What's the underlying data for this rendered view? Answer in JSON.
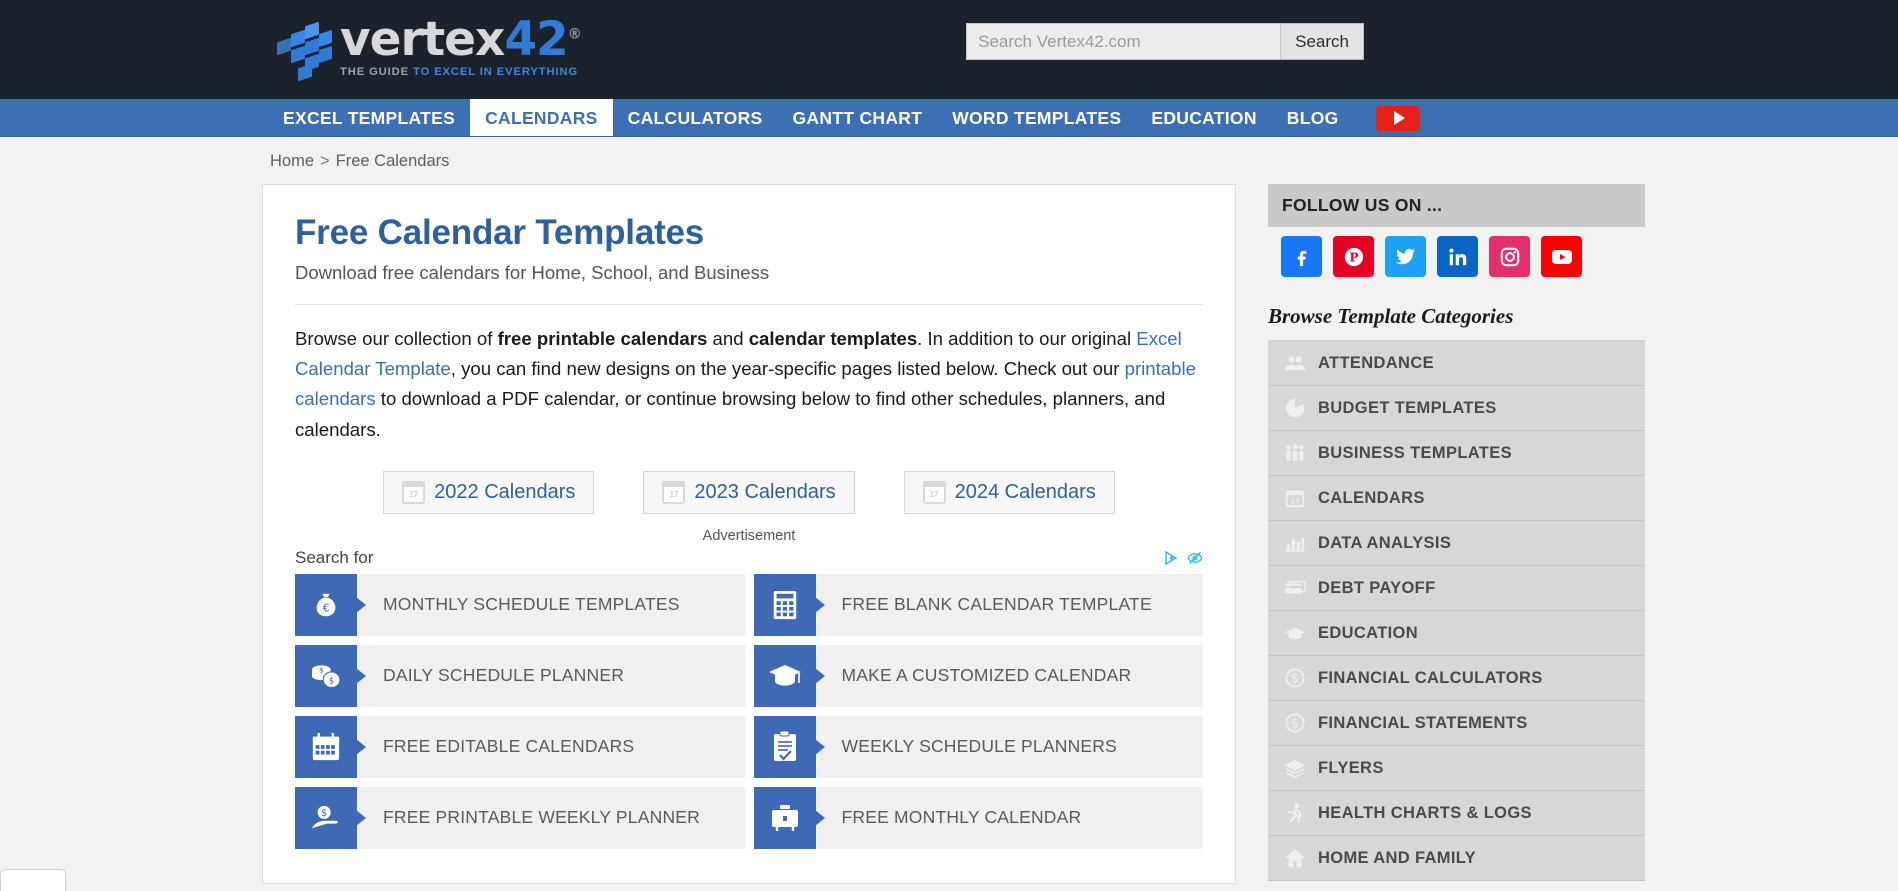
{
  "header": {
    "logo_word": "vertex",
    "logo_number": "42",
    "logo_reg": "®",
    "tagline_pre": "THE GUIDE ",
    "tagline_hi": "TO EXCEL IN EVERYTHING",
    "search_placeholder": "Search Vertex42.com",
    "search_value": "",
    "search_button": "Search"
  },
  "nav": {
    "items": [
      {
        "label": "EXCEL TEMPLATES",
        "active": false
      },
      {
        "label": "CALENDARS",
        "active": true
      },
      {
        "label": "CALCULATORS",
        "active": false
      },
      {
        "label": "GANTT CHART",
        "active": false
      },
      {
        "label": "WORD TEMPLATES",
        "active": false
      },
      {
        "label": "EDUCATION",
        "active": false
      },
      {
        "label": "BLOG",
        "active": false
      }
    ],
    "youtube_label": "YouTube"
  },
  "breadcrumb": {
    "home": "Home",
    "separator": ">",
    "current": "Free Calendars"
  },
  "main": {
    "title": "Free Calendar Templates",
    "subtitle": "Download free calendars for Home, School, and Business",
    "intro": {
      "t1": "Browse our collection of ",
      "b1": "free printable calendars",
      "t2": " and ",
      "b2": "calendar templates",
      "t3": ". In addition to our original ",
      "link1": "Excel Calendar Template",
      "t4": ", you can find new designs on the year-specific pages listed below. Check out our ",
      "link2": "printable calendars",
      "t5": " to download a PDF calendar, or continue browsing below to find other schedules, planners, and calendars."
    },
    "year_buttons": [
      {
        "label": "2022 Calendars"
      },
      {
        "label": "2023 Calendars"
      },
      {
        "label": "2024 Calendars"
      }
    ]
  },
  "ad": {
    "advertisement_label": "Advertisement",
    "search_for_label": "Search for",
    "adchoices_icon": "adchoices-icon",
    "hide_ad_icon": "hide-ad-icon",
    "tiles": [
      {
        "label": "MONTHLY SCHEDULE TEMPLATES",
        "icon": "money-bag-icon"
      },
      {
        "label": "FREE BLANK CALENDAR TEMPLATE",
        "icon": "calculator-icon"
      },
      {
        "label": "DAILY SCHEDULE PLANNER",
        "icon": "coins-icon"
      },
      {
        "label": "MAKE A CUSTOMIZED CALENDAR",
        "icon": "graduation-cap-icon"
      },
      {
        "label": "FREE EDITABLE CALENDARS",
        "icon": "calendar-icon"
      },
      {
        "label": "WEEKLY SCHEDULE PLANNERS",
        "icon": "clipboard-check-icon"
      },
      {
        "label": "FREE PRINTABLE WEEKLY PLANNER",
        "icon": "hand-money-icon"
      },
      {
        "label": "FREE MONTHLY CALENDAR",
        "icon": "briefcase-icon"
      }
    ]
  },
  "sidebar": {
    "follow_title": "FOLLOW US ON ...",
    "social": [
      {
        "name": "facebook",
        "glyph": "f",
        "color": "#1877f2"
      },
      {
        "name": "pinterest",
        "glyph": "P",
        "color": "#e60023"
      },
      {
        "name": "twitter",
        "glyph": "t",
        "color": "#1da1f2"
      },
      {
        "name": "linkedin",
        "glyph": "in",
        "color": "#0a66c2"
      },
      {
        "name": "instagram",
        "glyph": "o",
        "color": "#e1306c"
      },
      {
        "name": "youtube",
        "glyph": "▶",
        "color": "#ff0000"
      }
    ],
    "browse_title": "Browse Template Categories",
    "categories": [
      {
        "label": "ATTENDANCE",
        "icon": "people-icon"
      },
      {
        "label": "BUDGET TEMPLATES",
        "icon": "pie-chart-icon"
      },
      {
        "label": "BUSINESS TEMPLATES",
        "icon": "group-icon"
      },
      {
        "label": "CALENDARS",
        "icon": "calendar-icon"
      },
      {
        "label": "DATA ANALYSIS",
        "icon": "bar-chart-icon"
      },
      {
        "label": "DEBT PAYOFF",
        "icon": "credit-card-icon"
      },
      {
        "label": "EDUCATION",
        "icon": "graduation-cap-icon"
      },
      {
        "label": "FINANCIAL CALCULATORS",
        "icon": "dollar-icon"
      },
      {
        "label": "FINANCIAL STATEMENTS",
        "icon": "dollar-icon"
      },
      {
        "label": "FLYERS",
        "icon": "layers-icon"
      },
      {
        "label": "HEALTH CHARTS & LOGS",
        "icon": "running-person-icon"
      },
      {
        "label": "HOME AND FAMILY",
        "icon": "home-icon"
      }
    ]
  },
  "colors": {
    "header_bg": "#1b222c",
    "nav_bg": "#3d6fb5",
    "title_blue": "#2f5f9e",
    "ad_tile_blue": "#3f68b5",
    "sidebar_row": "#d7d7d7"
  }
}
